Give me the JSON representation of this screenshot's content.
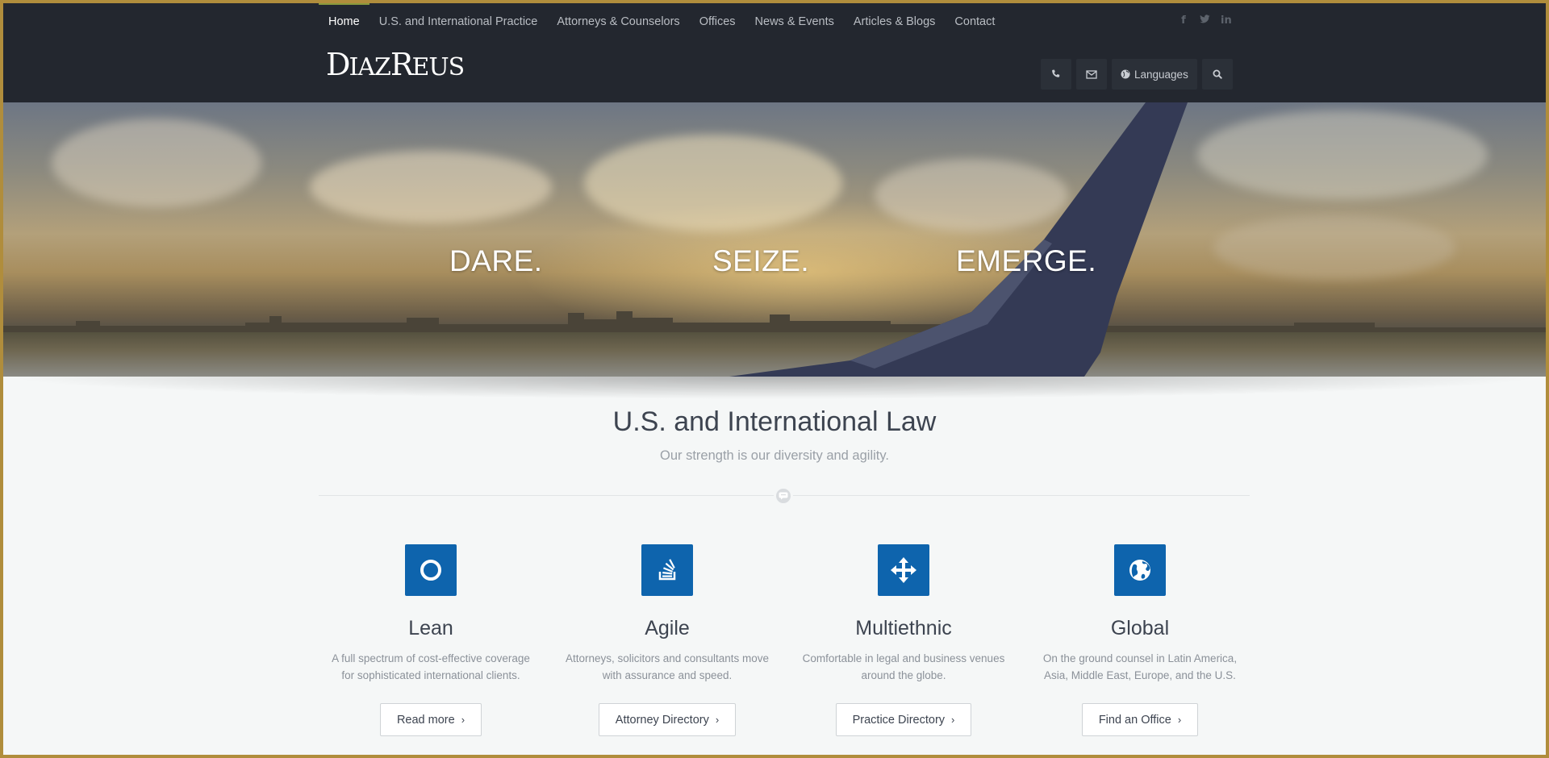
{
  "nav": {
    "items": [
      {
        "label": "Home",
        "active": true
      },
      {
        "label": "U.S. and International Practice"
      },
      {
        "label": "Attorneys & Counselors"
      },
      {
        "label": "Offices"
      },
      {
        "label": "News & Events"
      },
      {
        "label": "Articles & Blogs"
      },
      {
        "label": "Contact"
      }
    ],
    "social": [
      "facebook-icon",
      "twitter-icon",
      "linkedin-icon"
    ]
  },
  "logo": {
    "text": "DIAZREUS"
  },
  "tools": {
    "phone_icon": "phone-icon",
    "mail_icon": "envelope-icon",
    "languages_label": "Languages",
    "search_icon": "search-icon"
  },
  "hero": {
    "words": [
      "DARE.",
      "SEIZE.",
      "EMERGE."
    ]
  },
  "main": {
    "title": "U.S. and International Law",
    "subtitle": "Our strength is our diversity and agility."
  },
  "features": [
    {
      "icon": "circle-icon",
      "title": "Lean",
      "desc_lines": [
        "A full spectrum of cost-effective coverage",
        "for sophisticated international clients."
      ],
      "button": "Read more"
    },
    {
      "icon": "stack-overflow-icon",
      "title": "Agile",
      "desc_lines": [
        "Attorneys, solicitors and consultants move",
        "with assurance and speed."
      ],
      "button": "Attorney Directory"
    },
    {
      "icon": "move-arrows-icon",
      "title": "Multiethnic",
      "desc_lines": [
        "Comfortable in legal and business venues",
        "around the globe."
      ],
      "button": "Practice Directory"
    },
    {
      "icon": "globe-icon",
      "title": "Global",
      "desc_lines": [
        "On the ground counsel in Latin America,",
        "Asia, Middle East, Europe, and the U.S."
      ],
      "button": "Find an Office"
    }
  ],
  "colors": {
    "header_bg": "#23272f",
    "accent_blue": "#0e64ad",
    "frame": "#b08d3c",
    "nav_active_bar": "#8a9a3c"
  }
}
